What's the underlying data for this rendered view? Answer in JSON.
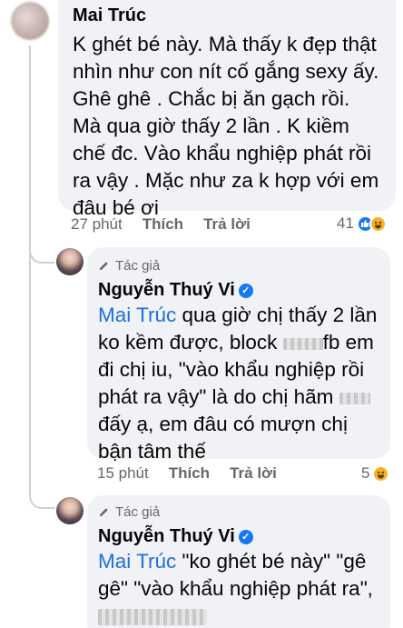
{
  "comment1": {
    "author": "Mai Trúc",
    "lines": [
      "K ghét bé này.  Mà thấy k đẹp thật",
      "nhìn như con nít cố gắng sexy ấy.",
      "Ghê ghê  .  Chắc bị ăn gạch rồi.",
      "Mà qua giờ thấy 2 lần . K kiềm",
      "chế đc. Vào khẩu nghiệp phát rồi",
      "ra vậy . Mặc như za k hợp với em",
      "đâu bé ơi"
    ],
    "time": "27 phút",
    "like": "Thích",
    "reply": "Trả lời",
    "reaction_count": "41"
  },
  "reply1": {
    "badge": "Tác giả",
    "author": "Nguyễn Thuý Vi",
    "mention": "Mai Trúc",
    "l1": " qua giờ chị thấy 2 lần",
    "l2a": "ko kềm được, block ",
    "l2b": "fb em",
    "l3": "đi chị iu, \"vào khẩu nghiệp rồi",
    "l4": "phát ra vậy\" là do chị hãm ",
    "l5": "đấy ạ, em đâu có mượn chị",
    "l6": "bận tâm thế",
    "time": "15 phút",
    "like": "Thích",
    "reply": "Trả lời",
    "reaction_count": "5"
  },
  "reply2": {
    "badge": "Tác giả",
    "author": "Nguyễn Thuý Vi",
    "mention": "Mai Trúc",
    "l1": " \"ko ghét bé này\" \"gê",
    "l2": "gê\" \"vào khẩu nghiệp phát ra\","
  }
}
